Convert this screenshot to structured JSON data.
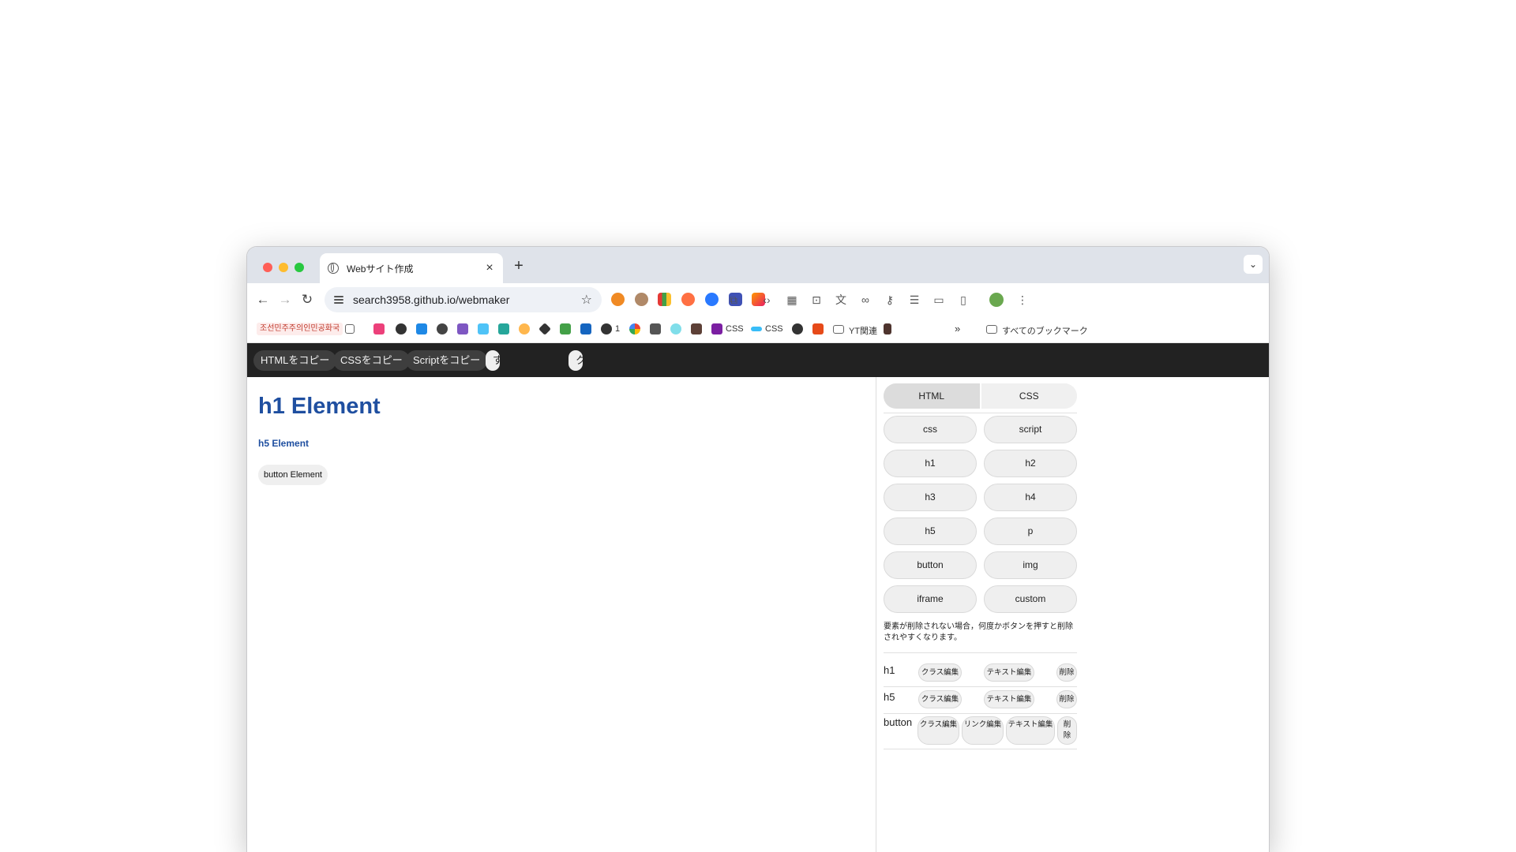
{
  "browser": {
    "tab_title": "Webサイト作成",
    "tab_close": "×",
    "new_tab": "+",
    "url": "search3958.github.io/webmaker",
    "bookmark_first": "조선민주주의인민공화국",
    "bookmark_labels": [
      "1",
      "CSS",
      "CSS",
      "YT関連"
    ],
    "bookmarks_overflow": "»",
    "all_bookmarks": "すべてのブックマーク"
  },
  "actions": {
    "copy_html": "HTMLをコピー",
    "copy_css": "CSSをコピー",
    "copy_script": "Scriptをコピー",
    "copy_all": "すべてをコピー",
    "clear": "クリア"
  },
  "preview": {
    "h1": "h1 Element",
    "h5": "h5 Element",
    "button": "button Element"
  },
  "sidebar": {
    "tabs": [
      "HTML",
      "CSS"
    ],
    "active_tab": "HTML",
    "element_buttons": [
      "css",
      "script",
      "h1",
      "h2",
      "h3",
      "h4",
      "h5",
      "p",
      "button",
      "img",
      "iframe",
      "custom"
    ],
    "note": "要素が削除されない場合，何度かボタンを押すと削除されやすくなります。",
    "elements": [
      {
        "name": "h1",
        "class_edit": "クラス編集",
        "text_edit": "テキスト編集",
        "delete": "削除"
      },
      {
        "name": "h5",
        "class_edit": "クラス編集",
        "text_edit": "テキスト編集",
        "delete": "削除"
      },
      {
        "name": "button",
        "class_edit": "クラス編集",
        "link_edit": "リンク編集",
        "text_edit": "テキスト編集",
        "delete": "削除"
      }
    ]
  },
  "colors": {
    "heading": "#1f4fa0",
    "action_bar": "#222222",
    "tab_strip": "#dfe3ea"
  }
}
